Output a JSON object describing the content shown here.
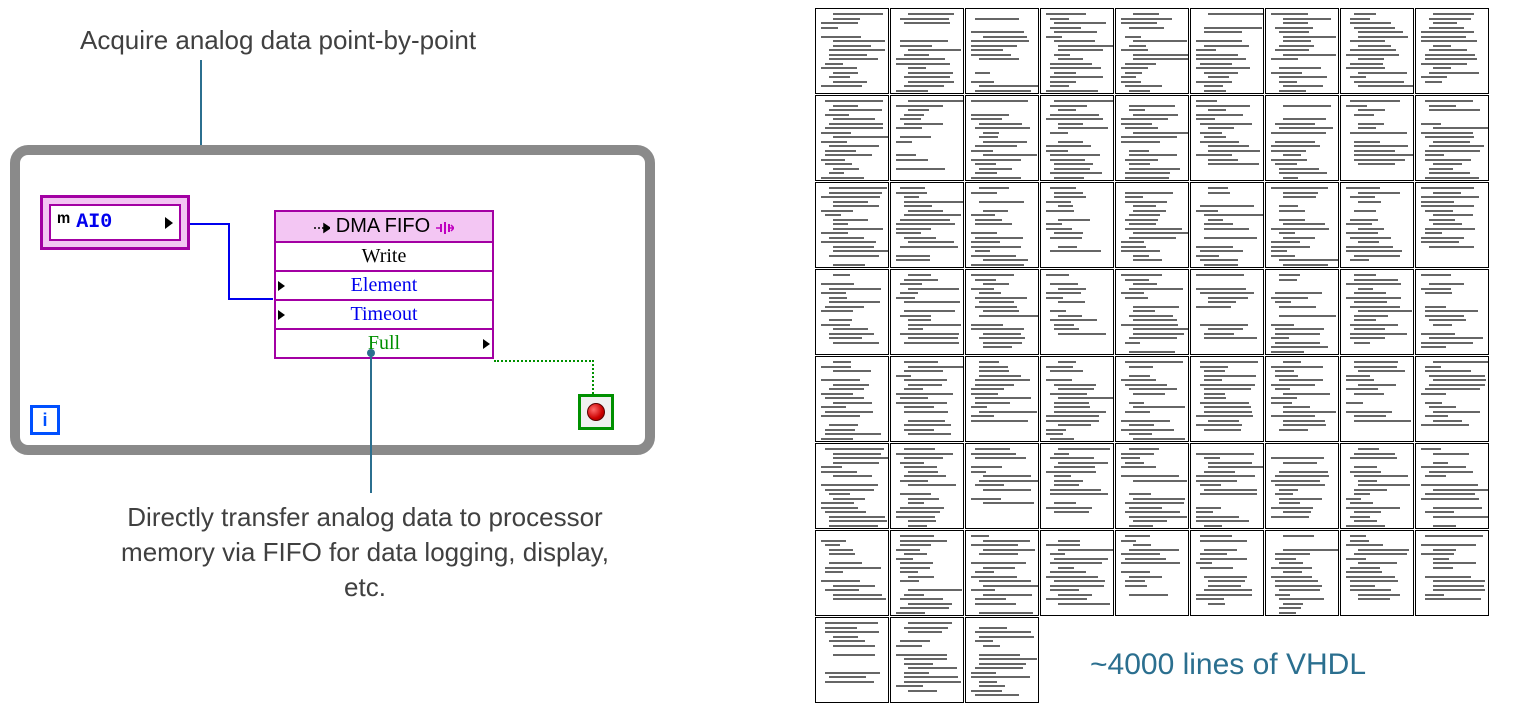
{
  "topCaption": "Acquire analog data point-by-point",
  "ai0": {
    "label": "AI0",
    "icon": "signal-wave"
  },
  "fifo": {
    "title": "DMA FIFO",
    "rows": [
      {
        "text": "Write",
        "cls": ""
      },
      {
        "text": "Element",
        "cls": "blue",
        "triL": true
      },
      {
        "text": "Timeout",
        "cls": "blue",
        "triL": true
      },
      {
        "text": "Full",
        "cls": "green",
        "triR": true
      }
    ]
  },
  "iTerminal": "i",
  "bottomCaption": "Directly transfer analog data to processor memory via FIFO for data logging, display, etc.",
  "vhdlCaption": "~4000 lines of VHDL",
  "pageGrid": {
    "rows": 8,
    "cols": 9,
    "lastRowCount": 3
  }
}
